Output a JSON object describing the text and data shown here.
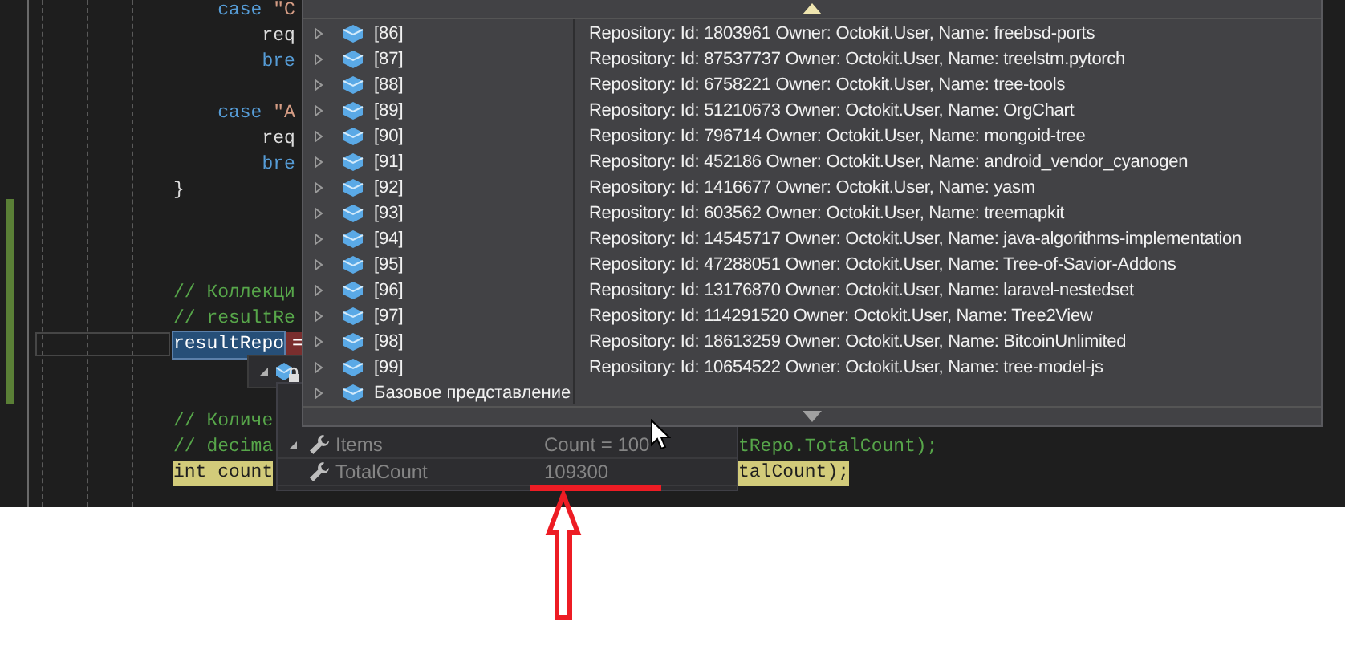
{
  "code_blocks": [
    {
      "lines": [
        {
          "current": false,
          "segments": [
            {
              "text": "    case ",
              "kind": "keyword"
            },
            {
              "text": "\"C",
              "kind": "string"
            }
          ]
        },
        {
          "current": false,
          "segments": [
            {
              "text": "        req",
              "kind": "plain"
            }
          ]
        },
        {
          "current": false,
          "segments": [
            {
              "text": "        bre",
              "kind": "keyword"
            }
          ]
        }
      ]
    },
    {
      "lines": [
        {
          "current": false,
          "segments": [
            {
              "text": "    case ",
              "kind": "keyword"
            },
            {
              "text": "\"A",
              "kind": "string"
            }
          ]
        },
        {
          "current": false,
          "segments": [
            {
              "text": "        req",
              "kind": "plain"
            }
          ]
        },
        {
          "current": false,
          "segments": [
            {
              "text": "        bre",
              "kind": "keyword"
            }
          ]
        },
        {
          "current": false,
          "segments": [
            {
              "text": "}",
              "kind": "plain"
            }
          ]
        }
      ]
    },
    {
      "lines": [
        {
          "current": false,
          "segments": [
            {
              "text": "// Коллекци",
              "kind": "comment"
            }
          ]
        },
        {
          "current": false,
          "segments": [
            {
              "text": "// resultRe",
              "kind": "comment"
            }
          ]
        },
        {
          "current": true,
          "segments": [
            {
              "text": "resultRepo",
              "kind": "selection"
            },
            {
              "text": "=",
              "kind": "error"
            }
          ]
        }
      ]
    },
    {
      "lines": [
        {
          "current": false,
          "segments": [
            {
              "text": "// Количе",
              "kind": "comment"
            }
          ]
        },
        {
          "current": false,
          "segments": [
            {
              "text": "// decima",
              "kind": "comment"
            }
          ],
          "tail": [
            {
              "text": "tRepo.TotalCount);",
              "kind": "comment"
            }
          ]
        },
        {
          "current": false,
          "segments": [
            {
              "text": "int count",
              "kind": "highlight"
            }
          ],
          "tail": [
            {
              "text": "talCount);",
              "kind": "highlight"
            }
          ]
        }
      ]
    }
  ],
  "datatip": {
    "expanded": true,
    "locked": true
  },
  "list": [
    {
      "name": "[86]",
      "value": "Repository: Id: 1803961 Owner: Octokit.User, Name: freebsd-ports",
      "expanded": false
    },
    {
      "name": "[87]",
      "value": "Repository: Id: 87537737 Owner: Octokit.User, Name: treelstm.pytorch",
      "expanded": false
    },
    {
      "name": "[88]",
      "value": "Repository: Id: 6758221 Owner: Octokit.User, Name: tree-tools",
      "expanded": false
    },
    {
      "name": "[89]",
      "value": "Repository: Id: 51210673 Owner: Octokit.User, Name: OrgChart",
      "expanded": false
    },
    {
      "name": "[90]",
      "value": "Repository: Id: 796714 Owner: Octokit.User, Name: mongoid-tree",
      "expanded": false
    },
    {
      "name": "[91]",
      "value": "Repository: Id: 452186 Owner: Octokit.User, Name: android_vendor_cyanogen",
      "expanded": false
    },
    {
      "name": "[92]",
      "value": "Repository: Id: 1416677 Owner: Octokit.User, Name: yasm",
      "expanded": false
    },
    {
      "name": "[93]",
      "value": "Repository: Id: 603562 Owner: Octokit.User, Name: treemapkit",
      "expanded": false
    },
    {
      "name": "[94]",
      "value": "Repository: Id: 14545717 Owner: Octokit.User, Name: java-algorithms-implementation",
      "expanded": false
    },
    {
      "name": "[95]",
      "value": "Repository: Id: 47288051 Owner: Octokit.User, Name: Tree-of-Savior-Addons",
      "expanded": false
    },
    {
      "name": "[96]",
      "value": "Repository: Id: 13176870 Owner: Octokit.User, Name: laravel-nestedset",
      "expanded": false
    },
    {
      "name": "[97]",
      "value": "Repository: Id: 114291520 Owner: Octokit.User, Name: Tree2View",
      "expanded": false
    },
    {
      "name": "[98]",
      "value": "Repository: Id: 18613259 Owner: Octokit.User, Name: BitcoinUnlimited",
      "expanded": false
    },
    {
      "name": "[99]",
      "value": "Repository: Id: 10654522 Owner: Octokit.User, Name: tree-model-js",
      "expanded": false
    },
    {
      "name": "Базовое представление",
      "expanded": false
    }
  ],
  "properties": [
    {
      "name": "Items",
      "value": "Count = 100",
      "expanded": true
    },
    {
      "name": "TotalCount",
      "value": "109300"
    }
  ]
}
